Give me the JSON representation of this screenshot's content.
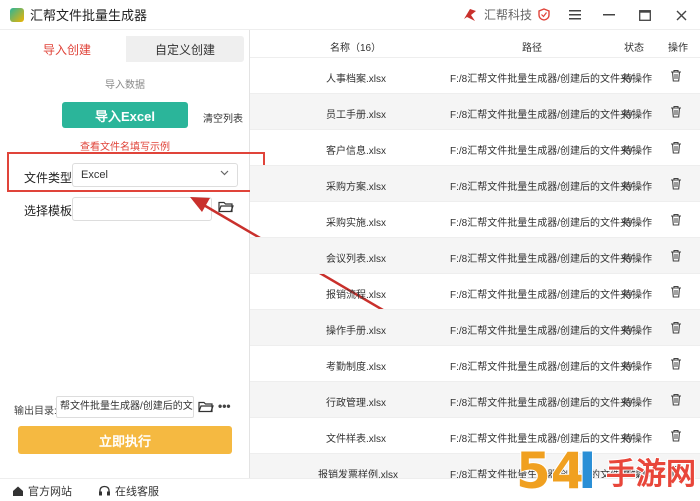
{
  "app": {
    "title": "汇帮文件批量生成器",
    "brand": "汇帮科技"
  },
  "tabs": [
    "导入创建",
    "自定义创建"
  ],
  "left": {
    "import_label": "导入数据",
    "import_button": "导入Excel",
    "clear_button": "清空列表",
    "example_link": "查看文件名填写示例",
    "file_type_label": "文件类型",
    "file_type_value": "Excel",
    "template_label": "选择模板",
    "template_value": "",
    "output_label": "输出目录:",
    "output_value": "帮文件批量生成器/创建后的文件夹",
    "run_button": "立即执行"
  },
  "table": {
    "headers": {
      "name": "名称（16）",
      "path": "路径",
      "status": "状态",
      "action": "操作"
    },
    "rows": [
      {
        "name": "人事档案.xlsx",
        "path": "F:/8汇帮文件批量生成器/创建后的文件夹/",
        "status": "待操作"
      },
      {
        "name": "员工手册.xlsx",
        "path": "F:/8汇帮文件批量生成器/创建后的文件夹/",
        "status": "待操作"
      },
      {
        "name": "客户信息.xlsx",
        "path": "F:/8汇帮文件批量生成器/创建后的文件夹/",
        "status": "待操作"
      },
      {
        "name": "采购方案.xlsx",
        "path": "F:/8汇帮文件批量生成器/创建后的文件夹/",
        "status": "待操作"
      },
      {
        "name": "采购实施.xlsx",
        "path": "F:/8汇帮文件批量生成器/创建后的文件夹/",
        "status": "待操作"
      },
      {
        "name": "会议列表.xlsx",
        "path": "F:/8汇帮文件批量生成器/创建后的文件夹/",
        "status": "待操作"
      },
      {
        "name": "报销流程.xlsx",
        "path": "F:/8汇帮文件批量生成器/创建后的文件夹/",
        "status": "待操作"
      },
      {
        "name": "操作手册.xlsx",
        "path": "F:/8汇帮文件批量生成器/创建后的文件夹/",
        "status": "待操作"
      },
      {
        "name": "考勤制度.xlsx",
        "path": "F:/8汇帮文件批量生成器/创建后的文件夹/",
        "status": "待操作"
      },
      {
        "name": "行政管理.xlsx",
        "path": "F:/8汇帮文件批量生成器/创建后的文件夹/",
        "status": "待操作"
      },
      {
        "name": "文件样表.xlsx",
        "path": "F:/8汇帮文件批量生成器/创建后的文件夹/",
        "status": "待操作"
      },
      {
        "name": "报销发票样例.xlsx",
        "path": "F:/8汇帮文件批量生成器/创建后的文件夹/",
        "status": "待操作"
      }
    ]
  },
  "footer": {
    "website": "官方网站",
    "support": "在线客服"
  },
  "watermark": {
    "text": "54Ⅰ手游网"
  },
  "colors": {
    "accent_red": "#e0443a",
    "teal": "#2bb59a",
    "run_orange": "#f5b941"
  }
}
